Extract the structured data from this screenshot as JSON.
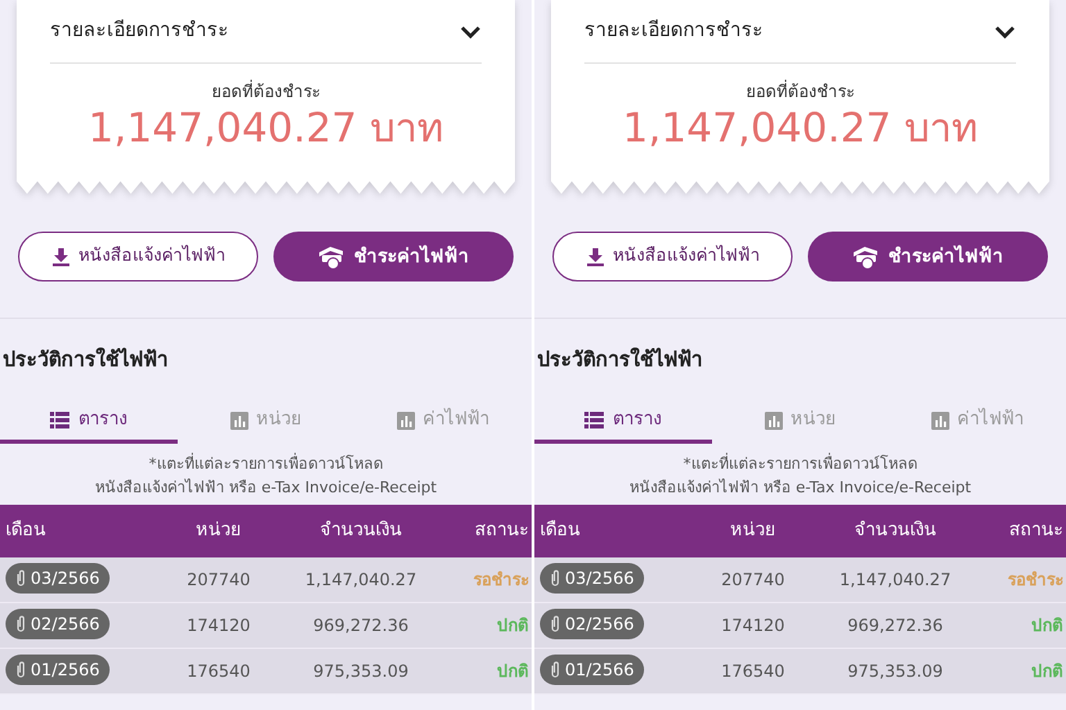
{
  "panels": [
    {
      "payment": {
        "title": "รายละเอียดการชำระ",
        "expanded": false,
        "due_label": "ยอดที่ต้องชำระ",
        "amount": "1,147,040.27 บาท"
      },
      "buttons": [
        {
          "label": "หนังสือแจ้งค่าไฟฟ้า",
          "kind": "outline"
        },
        {
          "label": "ชำระค่าไฟฟ้า",
          "kind": "filled"
        }
      ],
      "history": {
        "title": "ประวัติการใช้ไฟฟ้า",
        "tabs": [
          {
            "label": "ตาราง",
            "kind": "list",
            "selected": true
          },
          {
            "label": "หน่วย",
            "kind": "chart",
            "selected": false
          },
          {
            "label": "ค่าไฟฟ้า",
            "kind": "chart",
            "selected": false
          }
        ],
        "note": [
          "*แตะที่แต่ละรายการเพื่อดาวน์โหลด",
          "หนังสือแจ้งค่าไฟฟ้า หรือ e-Tax Invoice/e-Receipt"
        ],
        "columns": [
          "เดือน",
          "หน่วย",
          "จำนวนเงิน",
          "สถานะ"
        ],
        "rows": [
          {
            "month": "03/2566",
            "units": "207740",
            "amount": "1,147,040.27",
            "status": "รอชำระ",
            "kind": "pending"
          },
          {
            "month": "02/2566",
            "units": "174120",
            "amount": "969,272.36",
            "status": "ปกติ",
            "kind": "normal"
          },
          {
            "month": "01/2566",
            "units": "176540",
            "amount": "975,353.09",
            "status": "ปกติ",
            "kind": "normal"
          }
        ]
      }
    },
    {
      "payment": {
        "title": "รายละเอียดการชำระ",
        "expanded": false,
        "due_label": "ยอดที่ต้องชำระ",
        "amount": "1,147,040.27 บาท"
      },
      "buttons": [
        {
          "label": "หนังสือแจ้งค่าไฟฟ้า",
          "kind": "outline"
        },
        {
          "label": "ชำระค่าไฟฟ้า",
          "kind": "filled"
        }
      ],
      "history": {
        "title": "ประวัติการใช้ไฟฟ้า",
        "tabs": [
          {
            "label": "ตาราง",
            "kind": "list",
            "selected": true
          },
          {
            "label": "หน่วย",
            "kind": "chart",
            "selected": false
          },
          {
            "label": "ค่าไฟฟ้า",
            "kind": "chart",
            "selected": false
          }
        ],
        "note": [
          "*แตะที่แต่ละรายการเพื่อดาวน์โหลด",
          "หนังสือแจ้งค่าไฟฟ้า หรือ e-Tax Invoice/e-Receipt"
        ],
        "columns": [
          "เดือน",
          "หน่วย",
          "จำนวนเงิน",
          "สถานะ"
        ],
        "rows": [
          {
            "month": "03/2566",
            "units": "207740",
            "amount": "1,147,040.27",
            "status": "รอชำระ",
            "kind": "pending"
          },
          {
            "month": "02/2566",
            "units": "174120",
            "amount": "969,272.36",
            "status": "ปกติ",
            "kind": "normal"
          },
          {
            "month": "01/2566",
            "units": "176540",
            "amount": "975,353.09",
            "status": "ปกติ",
            "kind": "normal"
          }
        ]
      }
    }
  ]
}
